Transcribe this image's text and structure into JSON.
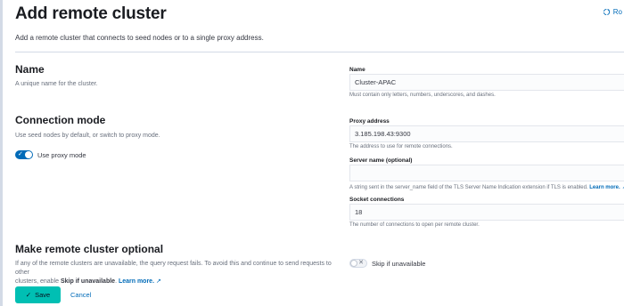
{
  "header": {
    "title": "Add remote cluster",
    "description": "Add a remote cluster that connects to seed nodes or to a single proxy address.",
    "corner_link": "Ro"
  },
  "name_section": {
    "title": "Name",
    "description": "A unique name for the cluster.",
    "field_label": "Name",
    "field_value": "Cluster-APAC",
    "field_help": "Must contain only letters, numbers, underscores, and dashes."
  },
  "connection_section": {
    "title": "Connection mode",
    "description": "Use seed nodes by default, or switch to proxy mode.",
    "proxy_toggle_label": "Use proxy mode",
    "proxy_toggle_on": true,
    "proxy_address_label": "Proxy address",
    "proxy_address_value": "3.185.198.43:9300",
    "proxy_address_help": "The address to use for remote connections.",
    "server_name_label": "Server name (optional)",
    "server_name_value": "",
    "server_name_help": "A string sent in the server_name field of the TLS Server Name Indication extension if TLS is enabled.",
    "server_name_link": "Learn more.",
    "socket_label": "Socket connections",
    "socket_value": "18",
    "socket_help": "The number of connections to open per remote cluster."
  },
  "optional_section": {
    "title": "Make remote cluster optional",
    "description_line1": "If any of the remote clusters are unavailable, the query request fails. To avoid this and continue to send requests to other",
    "description_line2_prefix": "clusters, enable",
    "description_bold": "Skip if unavailable",
    "description_link": "Learn more.",
    "skip_toggle_label": "Skip if unavailable",
    "skip_toggle_on": false
  },
  "actions": {
    "save_label": "Save",
    "cancel_label": "Cancel"
  },
  "colors": {
    "primary": "#006bb8",
    "save_button": "#00bfb3"
  }
}
